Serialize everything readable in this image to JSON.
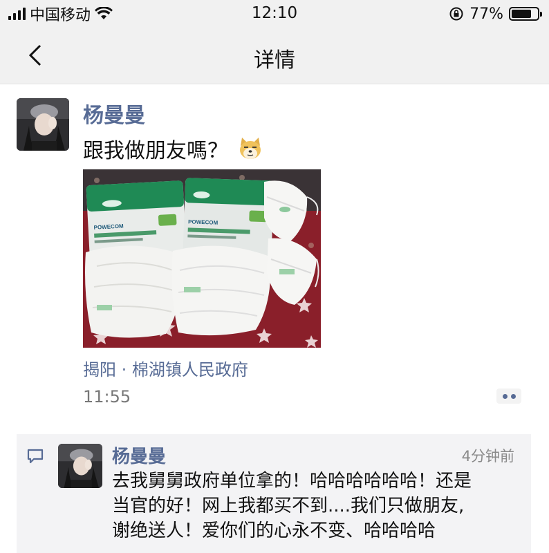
{
  "status_bar": {
    "carrier": "中国移动",
    "time": "12:10",
    "battery_percent": "77%",
    "battery_level": 0.77
  },
  "nav": {
    "title": "详情"
  },
  "post": {
    "author": "杨曼曼",
    "text": "跟我做朋友嗎？",
    "location": "揭阳 · 棉湖镇人民政府",
    "time": "11:55"
  },
  "comments": [
    {
      "author": "杨曼曼",
      "time": "4分钟前",
      "text": "去我舅舅政府单位拿的！哈哈哈哈哈哈！还是\n当官的好！网上我都买不到....我们只做朋友,\n谢绝送人！爱你们的心永不变、哈哈哈哈"
    }
  ],
  "photo": {
    "brand_text": "POWECOM"
  },
  "colors": {
    "link_blue": "#576b95",
    "bar_bg": "#f1f1f1",
    "comment_bg": "#f3f3f5"
  }
}
